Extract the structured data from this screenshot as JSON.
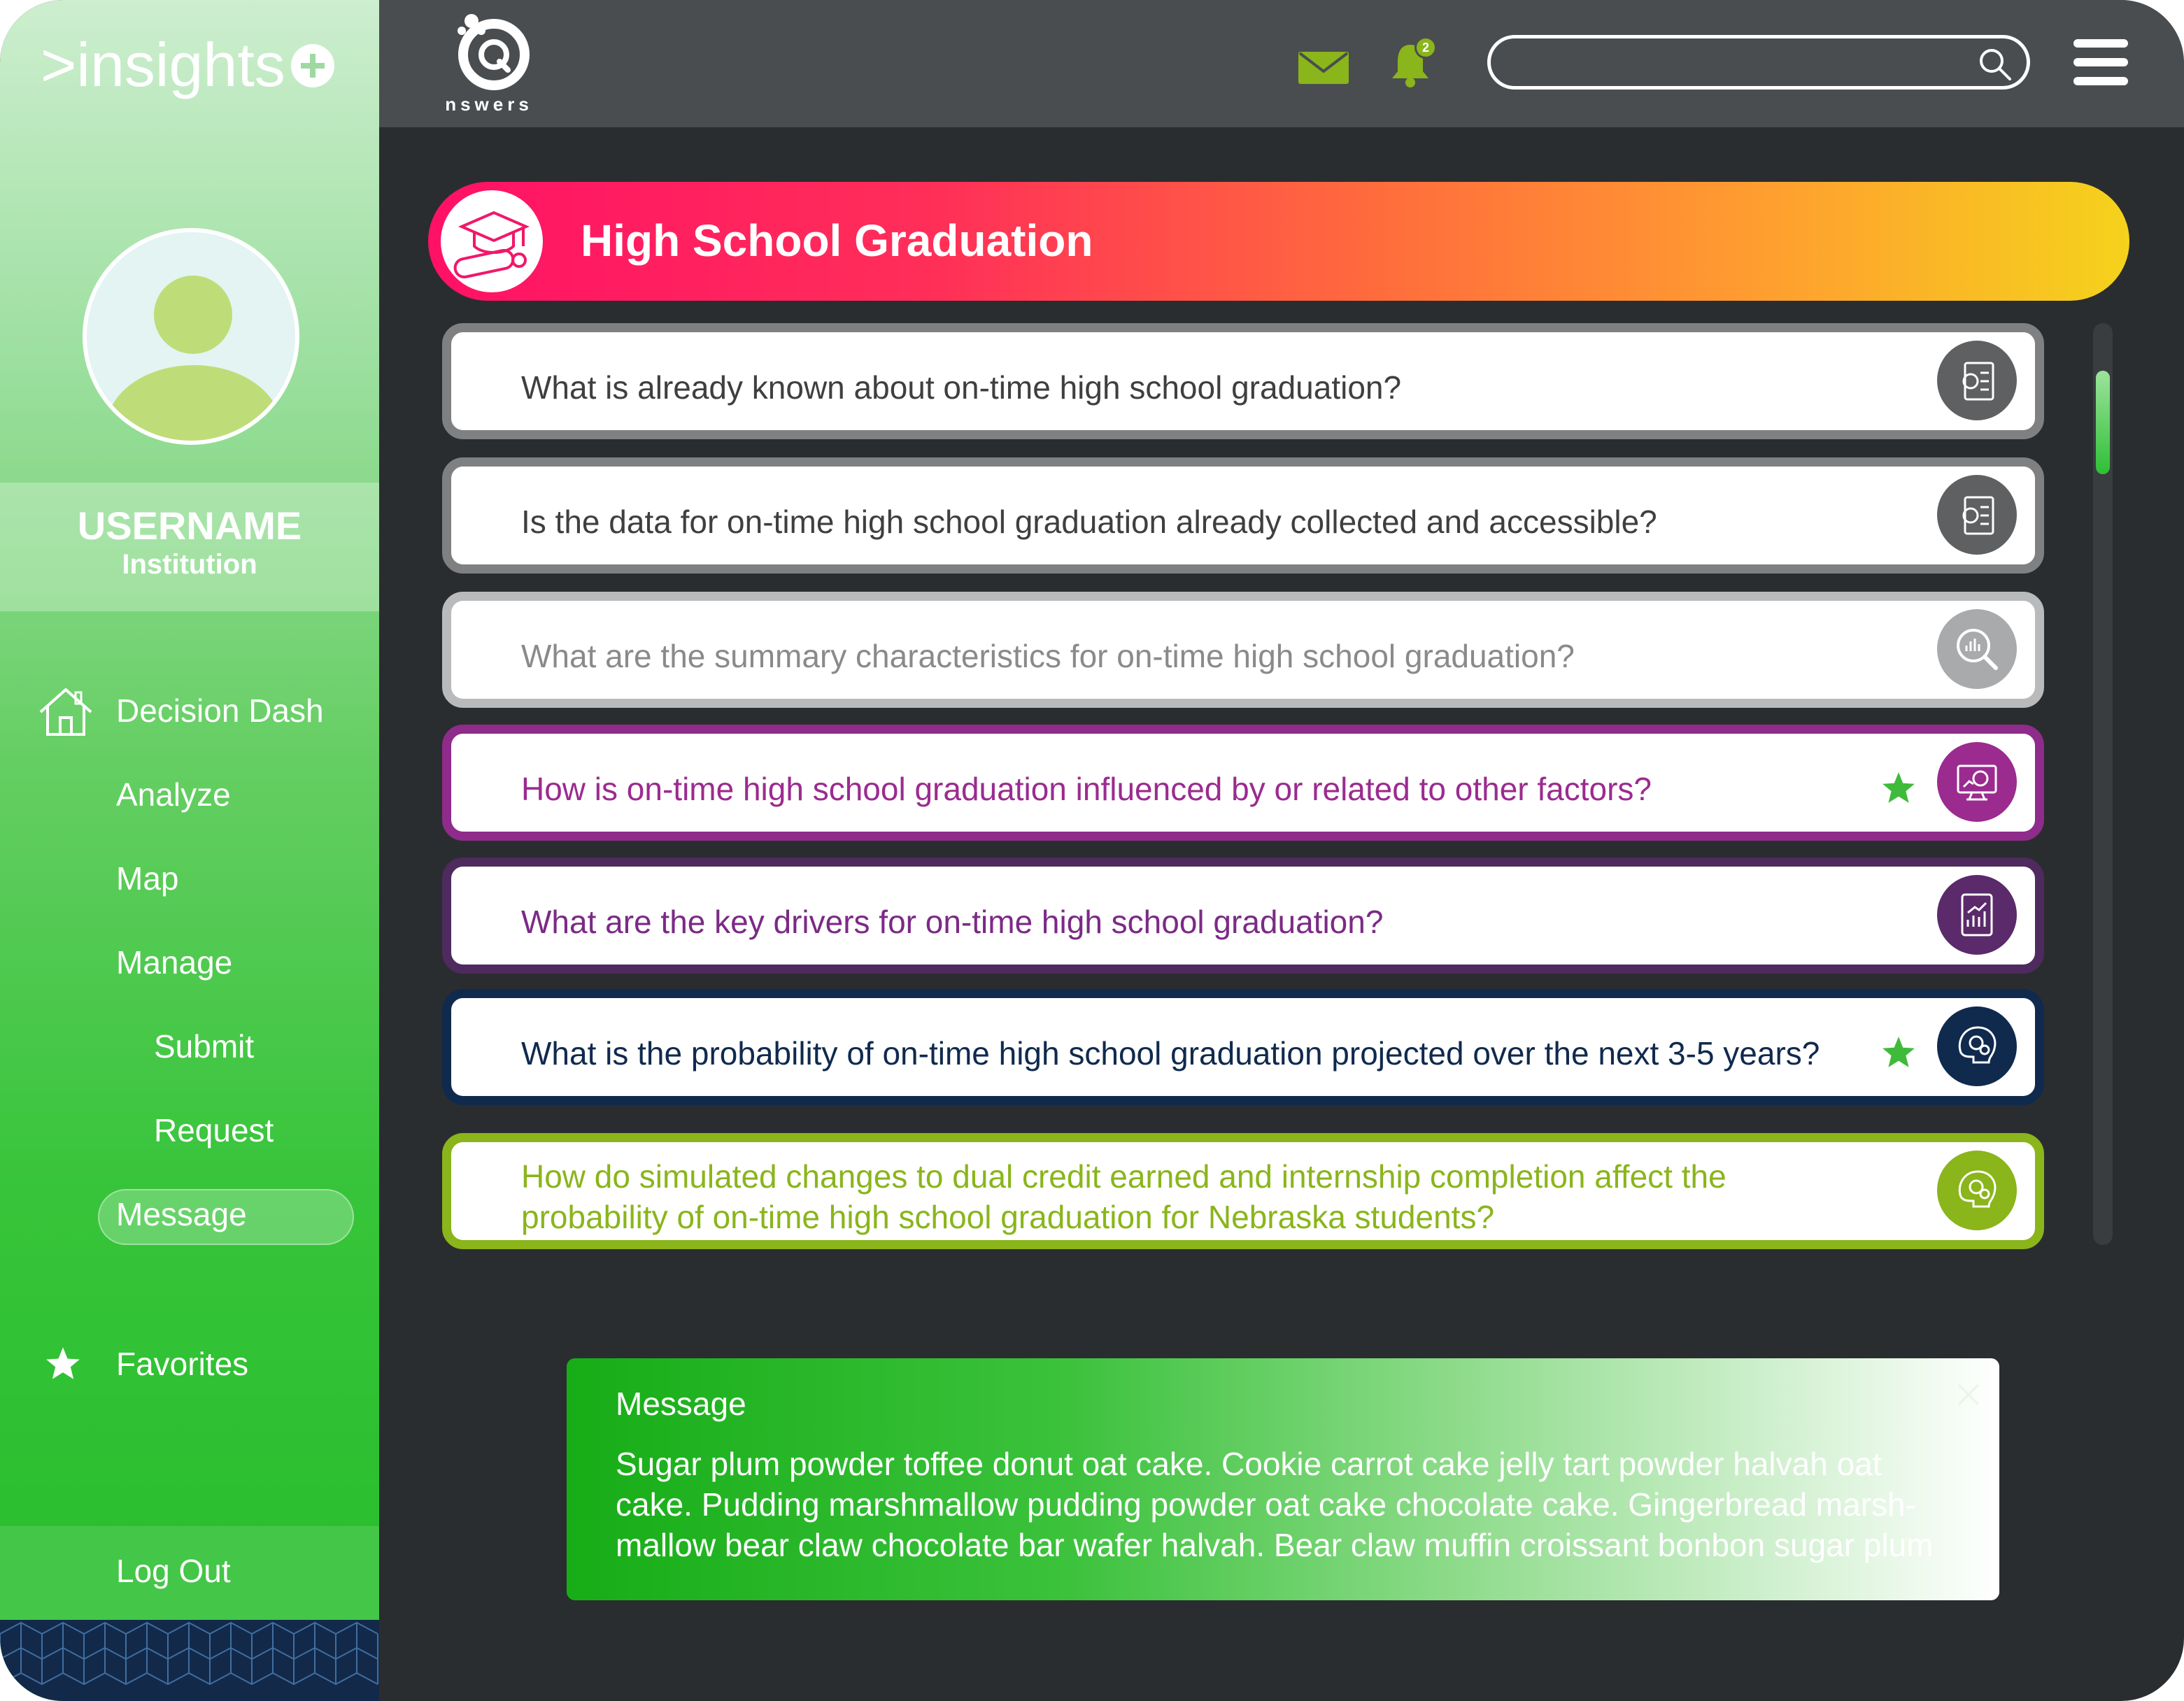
{
  "app": {
    "logo_prefix": ">",
    "logo_text": "insights",
    "brand_name": "nswers"
  },
  "user": {
    "username": "USERNAME",
    "institution": "Institution"
  },
  "sidebar": {
    "items": [
      {
        "label": "Decision Dash",
        "icon": "home-icon"
      },
      {
        "label": "Analyze"
      },
      {
        "label": "Map"
      },
      {
        "label": "Manage"
      },
      {
        "label": "Submit"
      },
      {
        "label": "Request"
      },
      {
        "label": "Message",
        "active": true
      }
    ],
    "favorites_label": "Favorites",
    "logout_label": "Log Out"
  },
  "topbar": {
    "notification_count": "2",
    "search_placeholder": "",
    "icons": [
      "mail-icon",
      "bell-icon",
      "search-icon",
      "hamburger-menu-icon"
    ]
  },
  "banner": {
    "title": "High School Graduation",
    "icon": "graduation-cap-icon"
  },
  "questions": [
    {
      "text": "What is already known about on-time high school graduation?",
      "color": "#3f3f3f",
      "icon": "document-settings-icon",
      "starred": false
    },
    {
      "text": "Is the data for on-time high school graduation already collected and accessible?",
      "color": "#3f3f3f",
      "icon": "document-settings-icon",
      "starred": false
    },
    {
      "text": "What are the summary characteristics for on-time high school graduation?",
      "color": "#8a8a8a",
      "icon": "magnify-chart-icon",
      "starred": false
    },
    {
      "text": "How is on-time high school graduation influenced by or related to other factors?",
      "color": "#9b2b8f",
      "icon": "monitor-chart-icon",
      "starred": true
    },
    {
      "text": "What are the key drivers for on-time high school graduation?",
      "color": "#7b2a86",
      "icon": "tablet-chart-icon",
      "starred": false
    },
    {
      "text": "What is the probability of on-time high school graduation projected over the next 3-5 years?",
      "color": "#102a4e",
      "icon": "head-gears-icon",
      "starred": true
    },
    {
      "text_line1": "How do simulated changes to dual credit earned and internship completion affect the",
      "text_line2": "probability of on-time high school graduation for Nebraska students?",
      "color": "#8ab51b",
      "icon": "head-gears-icon",
      "starred": false
    }
  ],
  "toast": {
    "title": "Message",
    "line1": "Sugar plum powder toffee donut oat cake. Cookie carrot cake jelly tart powder halvah oat",
    "line2": "cake. Pudding marshmallow pudding powder oat cake chocolate cake. Gingerbread marsh-",
    "line3": "mallow bear claw chocolate bar wafer halvah. Bear claw muffin croissant bonbon sugar plum"
  },
  "colors": {
    "sidebar_top": "#cdeecf",
    "sidebar_bottom": "#2bbf2f",
    "topbar": "#4a4d50",
    "background": "#2a2d2f",
    "accent_green": "#8ab51b",
    "banner_start": "#ff1166",
    "banner_end": "#f5d21c",
    "purple": "#9b2b8f",
    "dark_purple": "#5a2a6a",
    "navy": "#102a4e"
  }
}
